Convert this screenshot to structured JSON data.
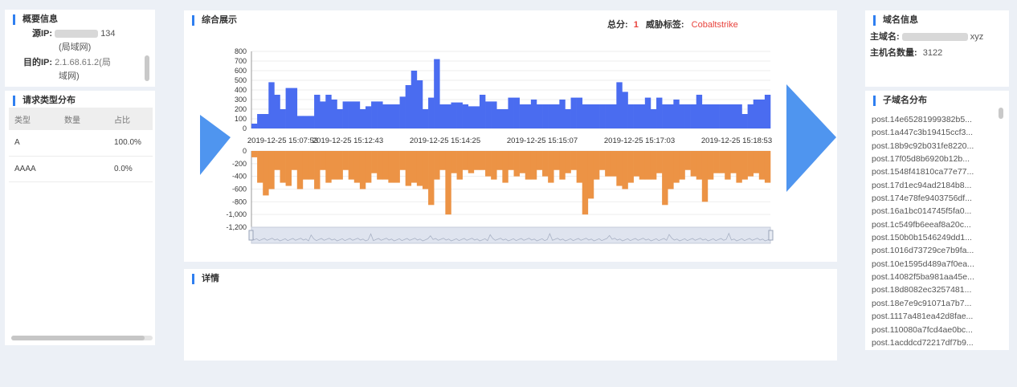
{
  "overview": {
    "title": "概要信息",
    "src_ip_label": "源IP:",
    "src_ip_value": "134",
    "src_ip_note": "(局域网)",
    "dst_ip_label": "目的IP:",
    "dst_ip_value": "2.1.68.61.2(局",
    "dst_ip_note": "域网)"
  },
  "request_types": {
    "title": "请求类型分布",
    "columns": [
      "类型",
      "数量",
      "占比"
    ],
    "rows": [
      {
        "type": "A",
        "count": "",
        "ratio": "100.0%"
      },
      {
        "type": "AAAA",
        "count": "",
        "ratio": "0.0%"
      }
    ]
  },
  "overview_chart": {
    "title": "综合展示",
    "score_label": "总分:",
    "score_value": "1",
    "tag_label": "威胁标签:",
    "tag_value": "Cobaltstrike",
    "score_color": "#e8423c"
  },
  "details": {
    "title": "详情"
  },
  "domain_info": {
    "title": "域名信息",
    "main_domain_label": "主域名:",
    "main_domain_value": "xyz",
    "host_count_label": "主机名数量:",
    "host_count_value": "3122"
  },
  "subdomain": {
    "title": "子域名分布",
    "items": [
      "post.14e65281999382b5...",
      "post.1a447c3b19415ccf3...",
      "post.18b9c92b031fe8220...",
      "post.17f05d8b6920b12b...",
      "post.1548f41810ca77e77...",
      "post.17d1ec94ad2184b8...",
      "post.174e78fe9403756df...",
      "post.16a1bc014745f5fa0...",
      "post.1c549fb6eeaf8a20c...",
      "post.150b0b1546249dd1...",
      "post.1016d73729ce7b9fa...",
      "post.10e1595d489a7f0ea...",
      "post.14082f5ba981aa45e...",
      "post.18d8082ec3257481...",
      "post.18e7e9c91071a7b7...",
      "post.1117a481ea42d8fae...",
      "post.110080a7fcd4ae0bc...",
      "post.1acddcd72217df7b9..."
    ]
  },
  "chart_data": {
    "type": "bar",
    "colors": {
      "top": "#4a6cf0",
      "bottom": "#ec9345",
      "arrow": "#4f95ef"
    },
    "top_axis": {
      "ticks": [
        0,
        100,
        200,
        300,
        400,
        500,
        600,
        700,
        800
      ],
      "ylim": [
        0,
        800
      ]
    },
    "bottom_axis": {
      "ticks": [
        "0",
        "-200",
        "-400",
        "-600",
        "-800",
        "-1,000",
        "-1,200"
      ],
      "ylim": [
        -1200,
        0
      ]
    },
    "x_labels": [
      "2019-12-25 15:07:53",
      "2019-12-25 15:12:43",
      "2019-12-25 15:14:25",
      "2019-12-25 15:15:07",
      "2019-12-25 15:17:03",
      "2019-12-25 15:18:53"
    ],
    "top_values": [
      50,
      150,
      150,
      480,
      350,
      200,
      420,
      420,
      130,
      130,
      130,
      350,
      280,
      350,
      300,
      200,
      280,
      280,
      280,
      200,
      230,
      280,
      280,
      250,
      250,
      250,
      330,
      450,
      600,
      500,
      200,
      320,
      720,
      250,
      250,
      270,
      270,
      250,
      230,
      230,
      350,
      280,
      280,
      200,
      200,
      320,
      320,
      250,
      250,
      300,
      250,
      250,
      250,
      250,
      300,
      200,
      320,
      320,
      250,
      250,
      250,
      250,
      250,
      250,
      480,
      380,
      250,
      250,
      250,
      320,
      200,
      320,
      250,
      250,
      300,
      250,
      250,
      250,
      350,
      250,
      250,
      250,
      250,
      250,
      250,
      250,
      150,
      250,
      300,
      300,
      350
    ],
    "bottom_values": [
      -100,
      -500,
      -700,
      -600,
      -300,
      -500,
      -550,
      -300,
      -600,
      -450,
      -450,
      -600,
      -300,
      -500,
      -450,
      -450,
      -300,
      -450,
      -500,
      -600,
      -500,
      -350,
      -450,
      -450,
      -500,
      -500,
      -300,
      -550,
      -500,
      -550,
      -600,
      -850,
      -450,
      -300,
      -1000,
      -350,
      -450,
      -300,
      -350,
      -300,
      -300,
      -400,
      -450,
      -300,
      -500,
      -300,
      -400,
      -350,
      -450,
      -450,
      -300,
      -400,
      -500,
      -300,
      -450,
      -350,
      -300,
      -500,
      -1000,
      -750,
      -450,
      -300,
      -400,
      -400,
      -550,
      -600,
      -500,
      -400,
      -450,
      -450,
      -450,
      -350,
      -850,
      -600,
      -500,
      -450,
      -300,
      -400,
      -450,
      -800,
      -450,
      -350,
      -350,
      -450,
      -350,
      -500,
      -450,
      -400,
      -350,
      -450,
      -500
    ]
  }
}
